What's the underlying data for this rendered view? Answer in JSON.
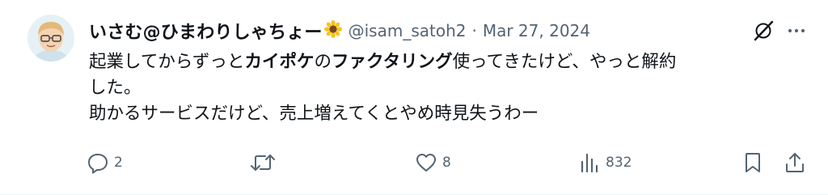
{
  "tweet": {
    "display_name": "いさむ@ひまわりしゃちょー",
    "name_emoji": "sunflower-icon",
    "handle": "@isam_satoh2",
    "separator": "·",
    "date": "Mar 27, 2024",
    "body": {
      "line1_a": "起業してからずっと",
      "line1_b": "カイポケ",
      "line1_c": "の",
      "line1_d": "ファクタリング",
      "line1_e": "使ってきたけど、やっと解約",
      "line2": "した。",
      "line3": "助かるサービスだけど、売上増えてくとやめ時見失うわー"
    },
    "actions": {
      "reply_count": "2",
      "retweet_count": "",
      "like_count": "8",
      "views_count": "832"
    }
  },
  "colors": {
    "text": "#0f1419",
    "secondary": "#536471",
    "sunflower_petal": "#f7c31a",
    "sunflower_center": "#7a4a1e"
  }
}
